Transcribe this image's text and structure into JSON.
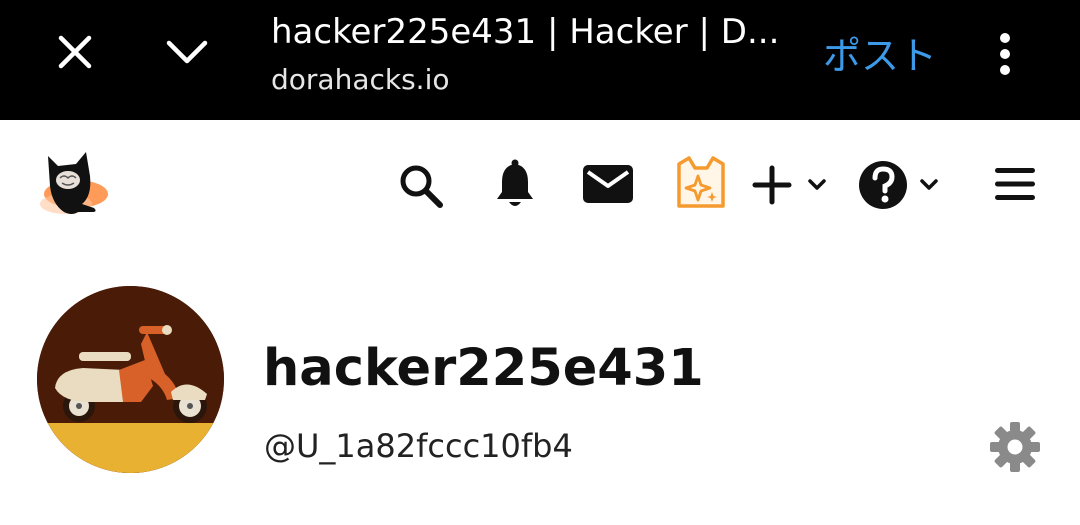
{
  "browser": {
    "title": "hacker225e431 | Hacker | D...",
    "url": "dorahacks.io",
    "post_label": "ポスト",
    "close_icon": "close-icon",
    "collapse_icon": "chevron-down-icon",
    "menu_icon": "more-vert-icon"
  },
  "header": {
    "logo": "dorahacks-cat-logo",
    "icons": [
      "search-icon",
      "bell-icon",
      "mail-icon",
      "cat-sparkle-icon",
      "plus-icon",
      "help-icon",
      "menu-icon"
    ]
  },
  "profile": {
    "username": "hacker225e431",
    "handle": "@U_1a82fccc10fb4",
    "avatar": "scooter-avatar",
    "settings_icon": "gear-icon"
  },
  "colors": {
    "browser_bar": "#000000",
    "post_link": "#3d9ae8",
    "cat_icon_accent": "#f59a2e",
    "gear": "#8a8a8a"
  }
}
